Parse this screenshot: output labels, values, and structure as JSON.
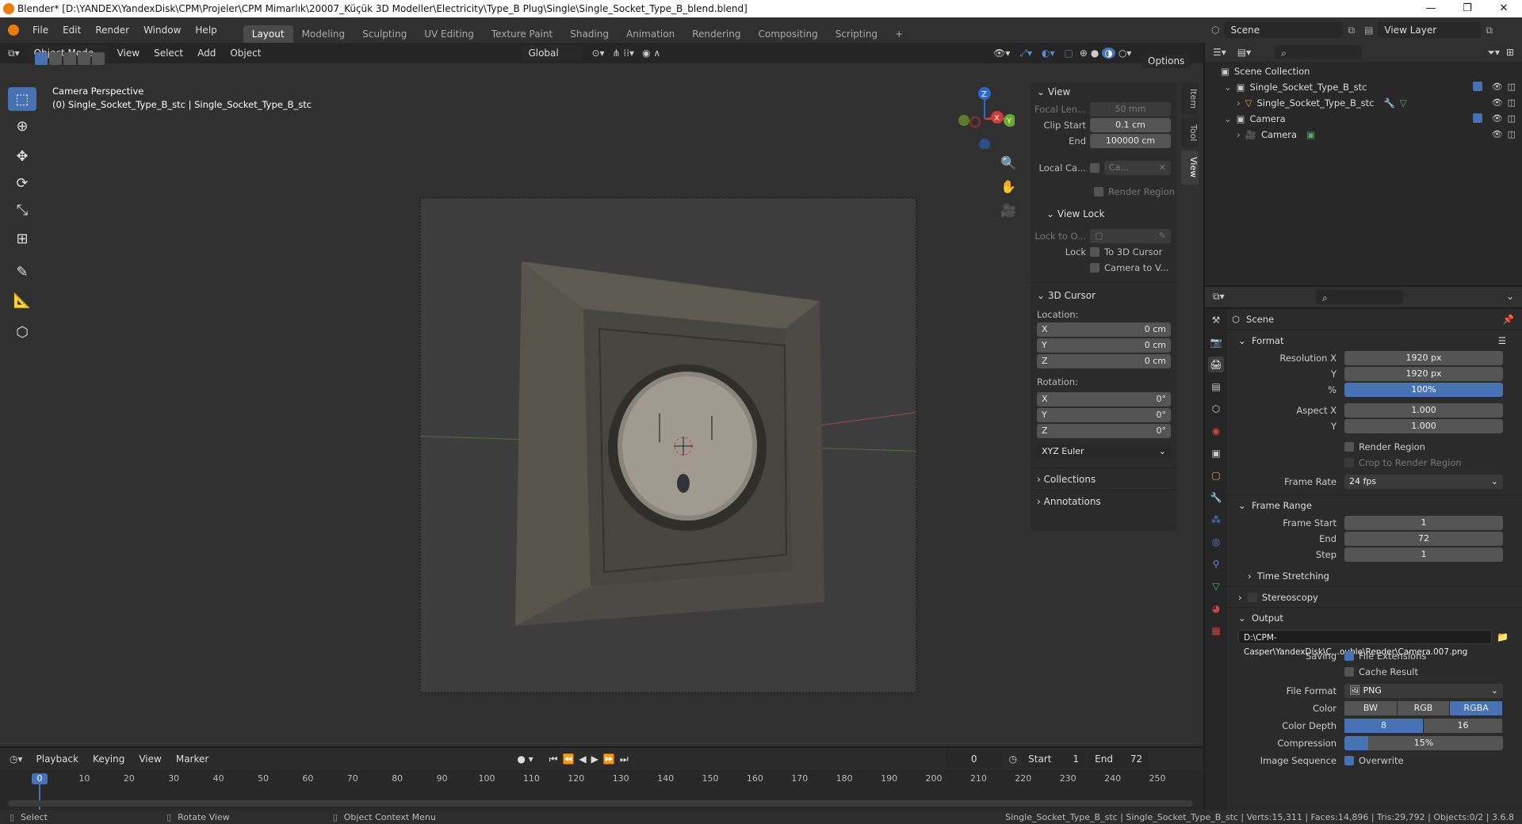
{
  "window": {
    "title": "Blender* [D:\\YANDEX\\YandexDisk\\CPM\\Projeler\\CPM Mimarlık\\20007_Küçük 3D Modeller\\Electricity\\Type_B Plug\\Single\\Single_Socket_Type_B_blend.blend]",
    "minimize": "—",
    "maximize": "❐",
    "close": "✕"
  },
  "menu": {
    "file": "File",
    "edit": "Edit",
    "render": "Render",
    "window": "Window",
    "help": "Help"
  },
  "workspaces": [
    "Layout",
    "Modeling",
    "Sculpting",
    "UV Editing",
    "Texture Paint",
    "Shading",
    "Animation",
    "Rendering",
    "Compositing",
    "Scripting",
    "+"
  ],
  "topright": {
    "scene": "Scene",
    "view_layer": "View Layer"
  },
  "viewport": {
    "mode": "Object Mode",
    "view": "View",
    "select": "Select",
    "add": "Add",
    "object": "Object",
    "orientation": "Global",
    "options": "Options",
    "overlay_title": "Camera Perspective",
    "overlay_sub": "(0) Single_Socket_Type_B_stc | Single_Socket_Type_B_stc",
    "gizmo_x": "X",
    "gizmo_y": "Y",
    "gizmo_z": "Z"
  },
  "npanel": {
    "tabs": [
      "Item",
      "Tool",
      "View"
    ],
    "view": {
      "title": "View",
      "focal_label": "Focal Len...",
      "focal_value": "50 mm",
      "clip_start_label": "Clip Start",
      "clip_start_value": "0.1 cm",
      "end_label": "End",
      "end_value": "100000 cm",
      "local_cam_label": "Local Ca...",
      "local_cam_value": "Ca...",
      "render_region": "Render Region"
    },
    "view_lock": {
      "title": "View Lock",
      "lock_to_label": "Lock to O...",
      "lock_label": "Lock",
      "to_cursor": "To 3D Cursor",
      "camera_to": "Camera to V..."
    },
    "cursor": {
      "title": "3D Cursor",
      "location": "Location:",
      "x": "X",
      "y": "Y",
      "z": "Z",
      "x_val": "0 cm",
      "y_val": "0 cm",
      "z_val": "0 cm",
      "rotation": "Rotation:",
      "rx": "0°",
      "ry": "0°",
      "rz": "0°",
      "mode": "XYZ Euler"
    },
    "collections": "Collections",
    "annotations": "Annotations"
  },
  "timeline": {
    "playback": "Playback",
    "keying": "Keying",
    "view": "View",
    "marker": "Marker",
    "current": "0",
    "start_label": "Start",
    "start": "1",
    "end_label": "End",
    "end": "72",
    "ticks": [
      "0",
      "10",
      "20",
      "30",
      "40",
      "50",
      "60",
      "70",
      "80",
      "90",
      "100",
      "110",
      "120",
      "130",
      "140",
      "150",
      "160",
      "170",
      "180",
      "190",
      "200",
      "210",
      "220",
      "230",
      "240",
      "250"
    ]
  },
  "status": {
    "select": "Select",
    "rotate": "Rotate View",
    "context": "Object Context Menu",
    "stats": "Single_Socket_Type_B_stc | Single_Socket_Type_B_stc | Verts:15,311 | Faces:14,896 | Tris:29,792 | Objects:0/2 | 3.6.8"
  },
  "outliner": {
    "root": "Scene Collection",
    "items": [
      {
        "label": "Single_Socket_Type_B_stc",
        "level": 1
      },
      {
        "label": "Single_Socket_Type_B_stc",
        "level": 2
      },
      {
        "label": "Camera",
        "level": 1
      },
      {
        "label": "Camera",
        "level": 2
      }
    ]
  },
  "props": {
    "scene": "Scene",
    "format": {
      "title": "Format",
      "res_x_label": "Resolution X",
      "res_x": "1920 px",
      "res_y_label": "Y",
      "res_y": "1920 px",
      "pct_label": "%",
      "pct": "100%",
      "aspect_x_label": "Aspect X",
      "aspect_x": "1.000",
      "aspect_y_label": "Y",
      "aspect_y": "1.000",
      "render_region": "Render Region",
      "crop": "Crop to Render Region",
      "frame_rate_label": "Frame Rate",
      "frame_rate": "24 fps"
    },
    "frame_range": {
      "title": "Frame Range",
      "start_label": "Frame Start",
      "start": "1",
      "end_label": "End",
      "end": "72",
      "step_label": "Step",
      "step": "1",
      "time_stretching": "Time Stretching"
    },
    "stereoscopy": "Stereoscopy",
    "output": {
      "title": "Output",
      "path": "D:\\CPM-Casper\\YandexDisk\\C...ouble\\Render\\Camera.007.png",
      "saving_label": "Saving",
      "file_ext": "File Extensions",
      "cache": "Cache Result",
      "file_format_label": "File Format",
      "file_format": "PNG",
      "color_label": "Color",
      "color_opts": [
        "BW",
        "RGB",
        "RGBA"
      ],
      "depth_label": "Color Depth",
      "depth_opts": [
        "8",
        "16"
      ],
      "compression_label": "Compression",
      "compression": "15%",
      "compression_fraction": 0.15,
      "image_seq_label": "Image Sequence",
      "overwrite": "Overwrite"
    }
  },
  "colors": {
    "accent": "#4772b3",
    "viewport_bg": "#3d3d3d",
    "panel_bg": "#2b2b2b"
  }
}
